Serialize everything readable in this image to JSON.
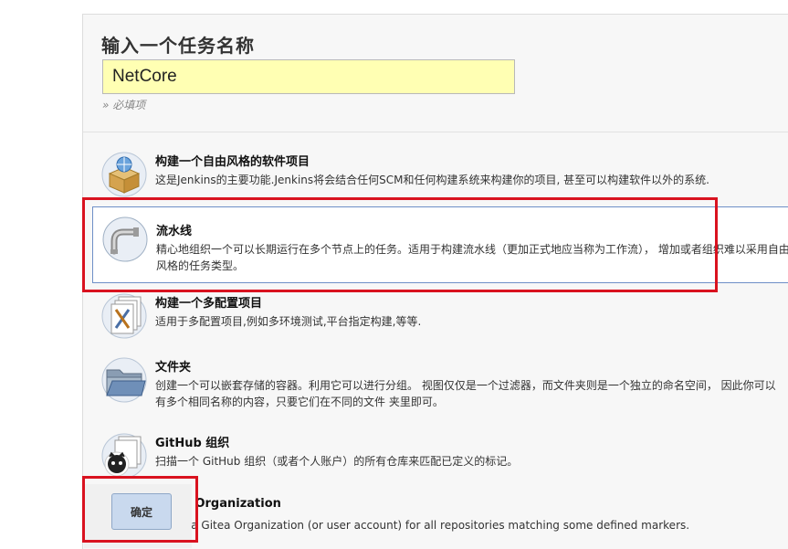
{
  "form": {
    "title": "输入一个任务名称",
    "name_value": "NetCore",
    "required_hint": "» 必填项"
  },
  "project_types": [
    {
      "label": "构建一个自由风格的软件项目",
      "description": "这是Jenkins的主要功能.Jenkins将会结合任何SCM和任何构建系统来构建你的项目, 甚至可以构建软件以外的系统.",
      "icon": "freestyle-box-icon"
    },
    {
      "label": "流水线",
      "description": "精心地组织一个可以长期运行在多个节点上的任务。适用于构建流水线（更加正式地应当称为工作流）， 增加或者组织难以采用自由风格的任务类型。",
      "icon": "pipeline-icon",
      "selected": true
    },
    {
      "label": "构建一个多配置项目",
      "description": "适用于多配置项目,例如多环境测试,平台指定构建,等等.",
      "icon": "multi-config-icon"
    },
    {
      "label": "文件夹",
      "description": "创建一个可以嵌套存储的容器。利用它可以进行分组。 视图仅仅是一个过滤器，而文件夹则是一个独立的命名空间， 因此你可以有多个相同名称的内容，只要它们在不同的文件 夹里即可。",
      "icon": "folder-icon"
    },
    {
      "label": "GitHub 组织",
      "description": "扫描一个 GitHub 组织（或者个人账户）的所有仓库来匹配已定义的标记。",
      "icon": "github-org-icon"
    },
    {
      "label": "Gitea Organization",
      "description": "Scans a Gitea Organization (or user account) for all repositories matching some defined markers.",
      "icon": "gitea-icon"
    }
  ],
  "actions": {
    "ok_label": "确定"
  },
  "colors": {
    "input_bg": "#ffffb3",
    "highlight_red": "#d9121f",
    "ok_button_bg": "#c9d9ee"
  }
}
